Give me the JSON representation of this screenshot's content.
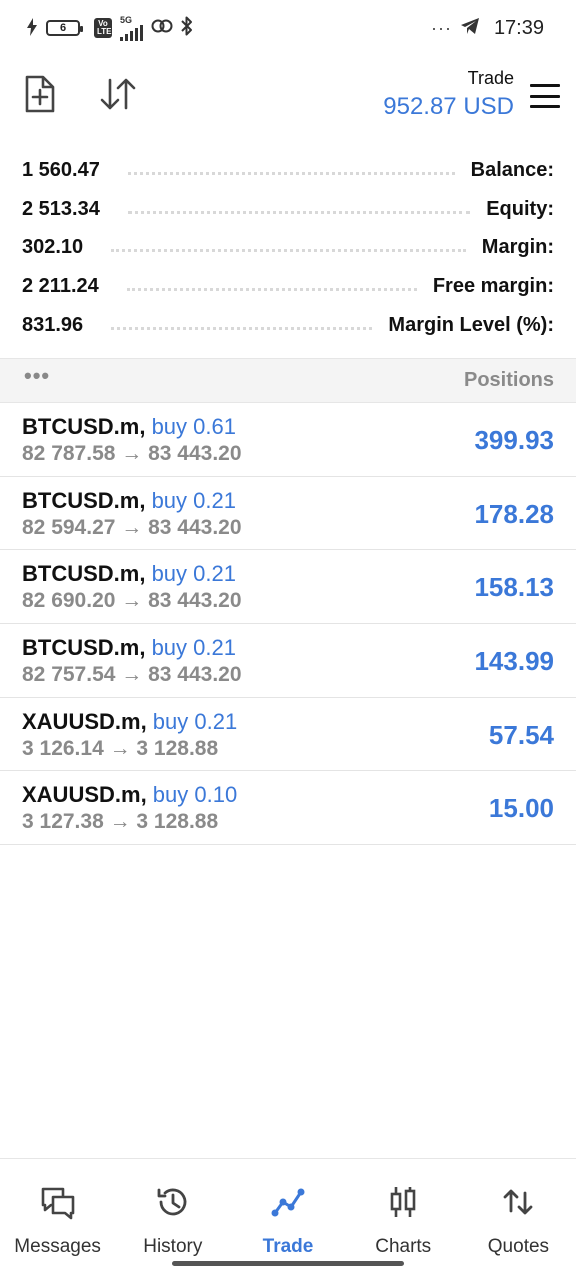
{
  "status_bar": {
    "battery": "6",
    "network": "5G",
    "volte": "Vo LTE",
    "time": "17:39",
    "icons": [
      "charging-icon",
      "battery-icon",
      "volte-icon",
      "signal-icon",
      "hotspot-icon",
      "bluetooth-icon",
      "more-dots-icon",
      "telegram-icon"
    ]
  },
  "header": {
    "title": "Trade",
    "profit": "952.87 USD",
    "icons": [
      "new-order-icon",
      "sort-icon",
      "menu-icon"
    ]
  },
  "summary": [
    {
      "value": "1 560.47",
      "label": "Balance:"
    },
    {
      "value": "2 513.34",
      "label": "Equity:"
    },
    {
      "value": "302.10",
      "label": "Margin:"
    },
    {
      "value": "2 211.24",
      "label": "Free margin:"
    },
    {
      "value": "831.96",
      "label": "Margin Level (%):"
    }
  ],
  "positions_header": {
    "more": "•••",
    "title": "Positions"
  },
  "positions": [
    {
      "symbol": "BTCUSD.m,",
      "side": "buy 0.61",
      "prices": "82 787.58 → 83 443.20",
      "profit": "399.93"
    },
    {
      "symbol": "BTCUSD.m,",
      "side": "buy 0.21",
      "prices": "82 594.27 → 83 443.20",
      "profit": "178.28"
    },
    {
      "symbol": "BTCUSD.m,",
      "side": "buy 0.21",
      "prices": "82 690.20 → 83 443.20",
      "profit": "158.13"
    },
    {
      "symbol": "BTCUSD.m,",
      "side": "buy 0.21",
      "prices": "82 757.54 → 83 443.20",
      "profit": "143.99"
    },
    {
      "symbol": "XAUUSD.m,",
      "side": "buy 0.21",
      "prices": "3 126.14 → 3 128.88",
      "profit": "57.54"
    },
    {
      "symbol": "XAUUSD.m,",
      "side": "buy 0.10",
      "prices": "3 127.38 → 3 128.88",
      "profit": "15.00"
    }
  ],
  "nav": [
    {
      "label": "Messages",
      "icon": "messages-icon",
      "active": false
    },
    {
      "label": "History",
      "icon": "history-icon",
      "active": false
    },
    {
      "label": "Trade",
      "icon": "trade-icon",
      "active": true
    },
    {
      "label": "Charts",
      "icon": "charts-icon",
      "active": false
    },
    {
      "label": "Quotes",
      "icon": "quotes-icon",
      "active": false
    }
  ],
  "colors": {
    "accent": "#3b78d8",
    "text": "#111111",
    "muted": "#8a8a8a",
    "section_bg": "#f4f4f4"
  }
}
